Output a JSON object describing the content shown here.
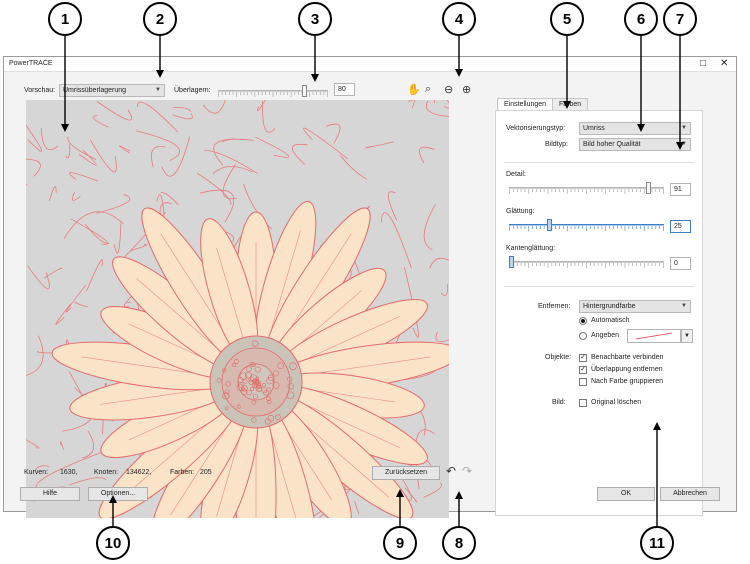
{
  "window": {
    "title": "PowerTRACE",
    "maximize_icon": "□",
    "close_icon": "✕"
  },
  "toolbar": {
    "preview_label": "Vorschau:",
    "preview_value": "Umrissüberlagerung",
    "overlay_label": "Überlagern:",
    "overlay_value": "80",
    "overlay_level": 0.8
  },
  "status": {
    "curves_label": "Kurven:",
    "curves_value": "1630,",
    "nodes_label": "Knoten:",
    "nodes_value": "134622,",
    "colors_label": "Farben:",
    "colors_value": "205"
  },
  "tabs": [
    {
      "label": "Einstellungen"
    },
    {
      "label": "Farben"
    }
  ],
  "settings": {
    "trace_type_label": "Vektorisierungstyp:",
    "trace_type_value": "Umriss",
    "image_type_label": "Bildtyp:",
    "image_type_value": "Bild hoher Qualität",
    "detail_label": "Detail:",
    "detail_value": "91",
    "detail_level": 0.91,
    "smoothing_label": "Glättung:",
    "smoothing_value": "25",
    "smoothing_level": 0.25,
    "corner_label": "Kantenglättung:",
    "corner_value": "0",
    "corner_level": 0.0,
    "remove_label": "Entfernen:",
    "remove_value": "Hintergrundfarbe",
    "auto_label": "Automatisch",
    "specify_label": "Angeben",
    "objects_label": "Objekte:",
    "merge_label": "Benachbarte verbinden",
    "overlap_label": "Überlappung entfernen",
    "group_label": "Nach Farbe gruppieren",
    "image_label": "Bild:",
    "delete_original_label": "Original löschen"
  },
  "buttons": {
    "reset": "Zurücksetzen",
    "help": "Hilfe",
    "options": "Optionen...",
    "ok": "OK",
    "cancel": "Abbrechen"
  },
  "callouts": [
    "1",
    "2",
    "3",
    "4",
    "5",
    "6",
    "7",
    "8",
    "9",
    "10",
    "11"
  ]
}
